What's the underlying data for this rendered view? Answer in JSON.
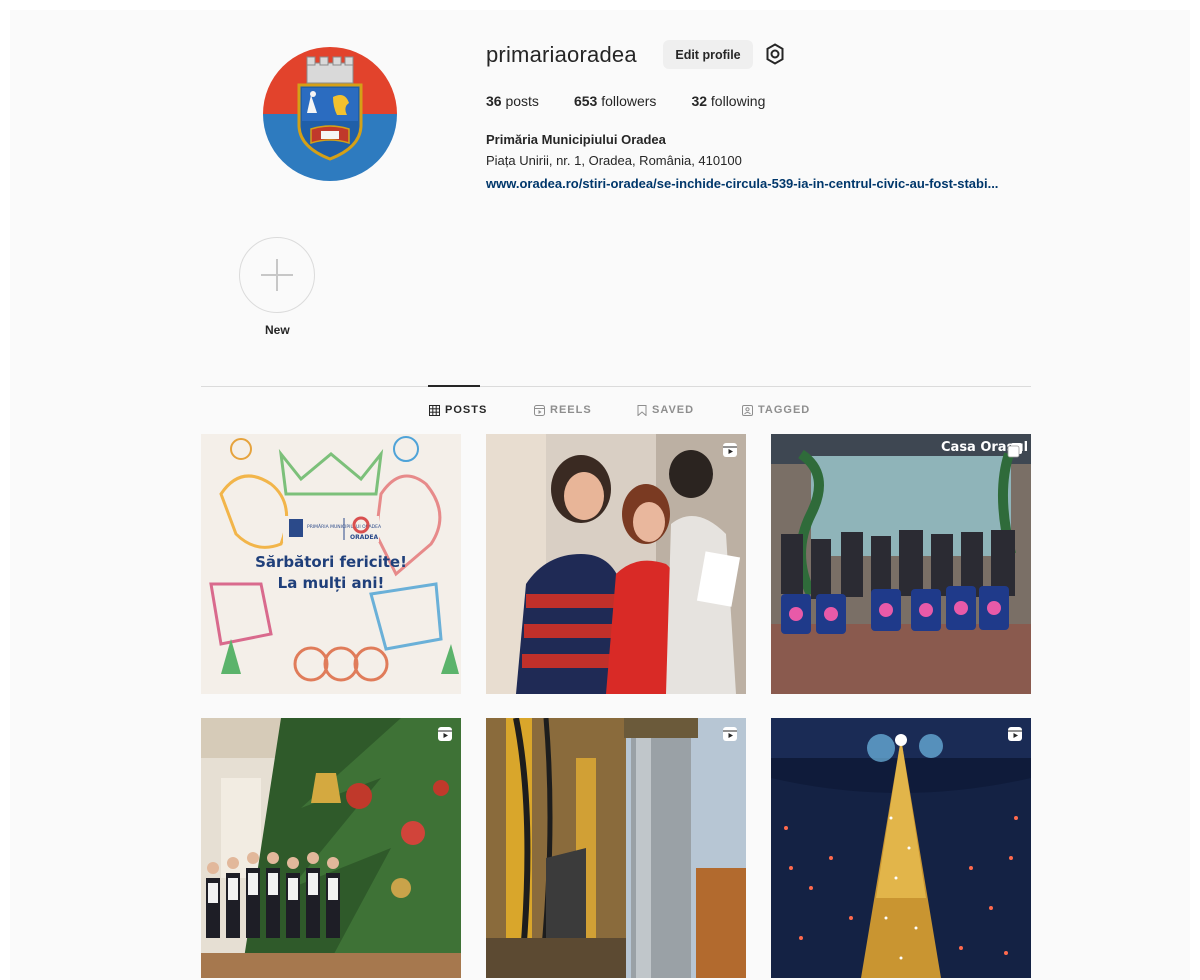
{
  "profile": {
    "username": "primariaoradea",
    "edit_label": "Edit profile",
    "posts_count": "36",
    "posts_label": "posts",
    "followers_count": "653",
    "followers_label": "followers",
    "following_count": "32",
    "following_label": "following",
    "full_name": "Primăria Municipiului Oradea",
    "address": "Piața Unirii, nr. 1, Oradea, România, 410100",
    "link": "www.oradea.ro/stiri-oradea/se-inchide-circula-539-ia-in-centrul-civic-au-fost-stabi..."
  },
  "highlights": {
    "new_label": "New"
  },
  "tabs": [
    {
      "label": "POSTS",
      "icon": "grid-icon",
      "active": true
    },
    {
      "label": "REELS",
      "icon": "reels-icon",
      "active": false
    },
    {
      "label": "SAVED",
      "icon": "bookmark-icon",
      "active": false
    },
    {
      "label": "TAGGED",
      "icon": "tag-icon",
      "active": false
    }
  ],
  "posts": [
    {
      "type": "image",
      "caption_line1": "Sărbători fericite!",
      "caption_line2": "La mulți ani!",
      "logo_text": "ORADEA",
      "logo_small": "PRIMĂRIA MUNICIPIULUI ORADEA"
    },
    {
      "type": "reel"
    },
    {
      "type": "carousel",
      "sign_text": "Casa Orașul"
    },
    {
      "type": "reel"
    },
    {
      "type": "reel"
    },
    {
      "type": "reel"
    }
  ],
  "colors": {
    "link": "#00376b",
    "button_bg": "#efefef",
    "divider": "#dbdbdb",
    "background": "#fafafa"
  }
}
